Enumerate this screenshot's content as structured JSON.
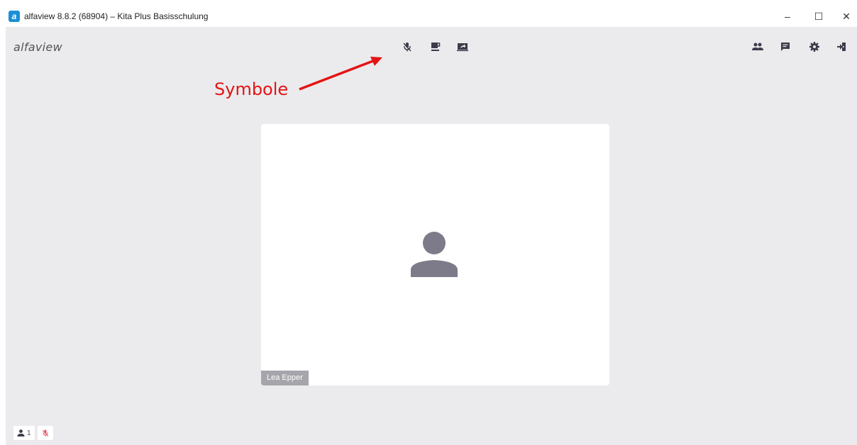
{
  "window": {
    "title": "alfaview 8.8.2 (68904) – Kita Plus Basisschulung",
    "app_icon_letter": "a",
    "controls": {
      "minimize": "–",
      "maximize": "☐",
      "close": "✕"
    }
  },
  "header": {
    "logo": "alfaview",
    "center_icons": [
      "mic-muted-icon",
      "coffee-break-icon",
      "screen-share-icon"
    ],
    "right_icons": [
      "participants-icon",
      "chat-icon",
      "settings-icon",
      "exit-icon"
    ]
  },
  "annotation": {
    "label": "Symbole",
    "color": "#e41414"
  },
  "video": {
    "participant_name": "Lea Epper",
    "avatar_color": "#7d7b89"
  },
  "status": {
    "participant_count": "1",
    "mic_state_icon": "mic-muted-icon",
    "mic_color": "#e05a6a"
  },
  "colors": {
    "background": "#ebebed",
    "icon": "#3d3b4a"
  }
}
